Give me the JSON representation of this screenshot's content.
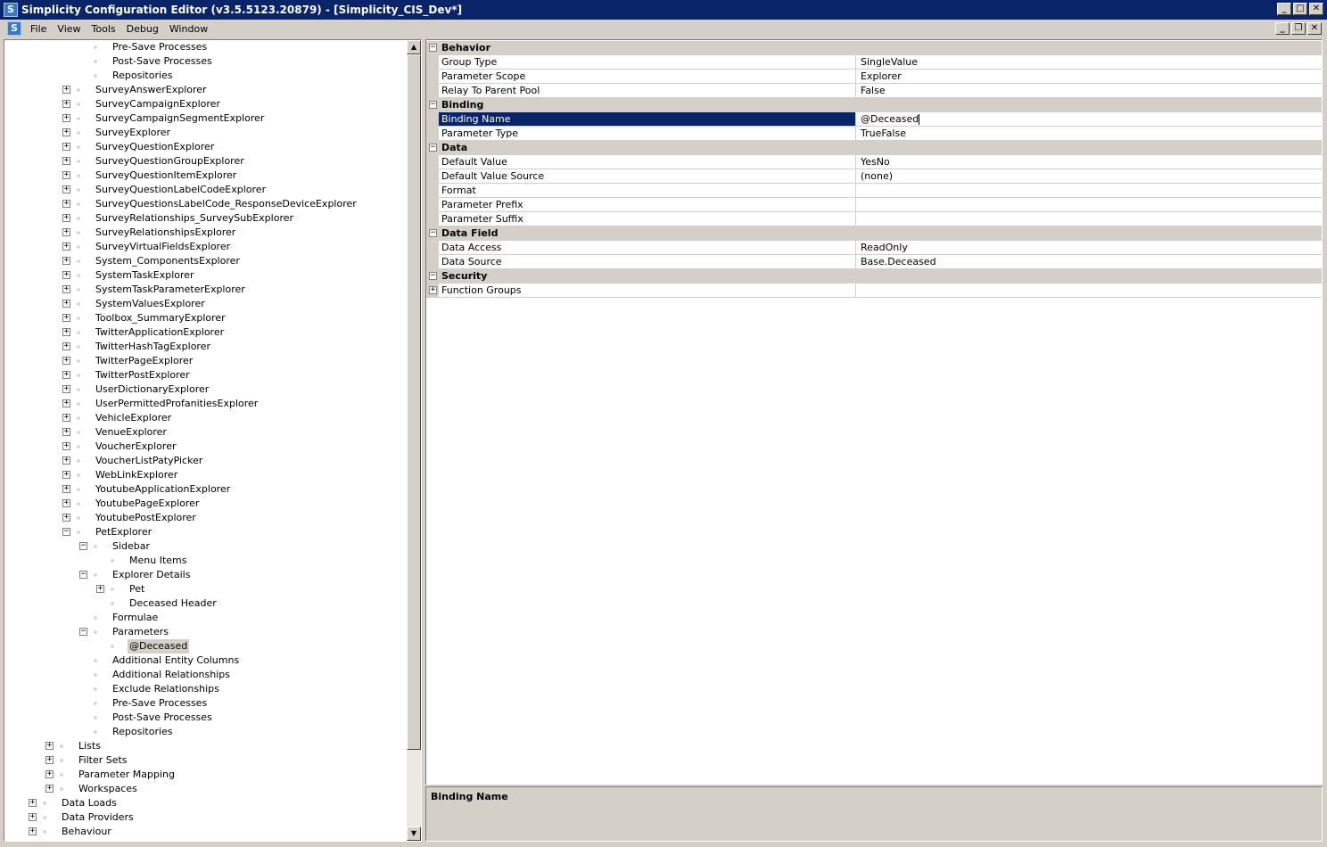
{
  "window": {
    "title": "Simplicity Configuration Editor (v3.5.5123.20879) - [Simplicity_CIS_Dev*]",
    "app_icon_letter": "S"
  },
  "menubar": {
    "items": [
      "File",
      "View",
      "Tools",
      "Debug",
      "Window"
    ]
  },
  "tree": {
    "items": [
      {
        "label": "Pre-Save Processes",
        "level": 3,
        "expander": "none"
      },
      {
        "label": "Post-Save Processes",
        "level": 3,
        "expander": "none"
      },
      {
        "label": "Repositories",
        "level": 3,
        "expander": "none"
      },
      {
        "label": "SurveyAnswerExplorer",
        "level": 2,
        "expander": "plus"
      },
      {
        "label": "SurveyCampaignExplorer",
        "level": 2,
        "expander": "plus"
      },
      {
        "label": "SurveyCampaignSegmentExplorer",
        "level": 2,
        "expander": "plus"
      },
      {
        "label": "SurveyExplorer",
        "level": 2,
        "expander": "plus"
      },
      {
        "label": "SurveyQuestionExplorer",
        "level": 2,
        "expander": "plus"
      },
      {
        "label": "SurveyQuestionGroupExplorer",
        "level": 2,
        "expander": "plus"
      },
      {
        "label": "SurveyQuestionItemExplorer",
        "level": 2,
        "expander": "plus"
      },
      {
        "label": "SurveyQuestionLabelCodeExplorer",
        "level": 2,
        "expander": "plus"
      },
      {
        "label": "SurveyQuestionsLabelCode_ResponseDeviceExplorer",
        "level": 2,
        "expander": "plus"
      },
      {
        "label": "SurveyRelationships_SurveySubExplorer",
        "level": 2,
        "expander": "plus"
      },
      {
        "label": "SurveyRelationshipsExplorer",
        "level": 2,
        "expander": "plus"
      },
      {
        "label": "SurveyVirtualFieldsExplorer",
        "level": 2,
        "expander": "plus"
      },
      {
        "label": "System_ComponentsExplorer",
        "level": 2,
        "expander": "plus"
      },
      {
        "label": "SystemTaskExplorer",
        "level": 2,
        "expander": "plus"
      },
      {
        "label": "SystemTaskParameterExplorer",
        "level": 2,
        "expander": "plus"
      },
      {
        "label": "SystemValuesExplorer",
        "level": 2,
        "expander": "plus"
      },
      {
        "label": "Toolbox_SummaryExplorer",
        "level": 2,
        "expander": "plus"
      },
      {
        "label": "TwitterApplicationExplorer",
        "level": 2,
        "expander": "plus"
      },
      {
        "label": "TwitterHashTagExplorer",
        "level": 2,
        "expander": "plus"
      },
      {
        "label": "TwitterPageExplorer",
        "level": 2,
        "expander": "plus"
      },
      {
        "label": "TwitterPostExplorer",
        "level": 2,
        "expander": "plus"
      },
      {
        "label": "UserDictionaryExplorer",
        "level": 2,
        "expander": "plus"
      },
      {
        "label": "UserPermittedProfanitiesExplorer",
        "level": 2,
        "expander": "plus"
      },
      {
        "label": "VehicleExplorer",
        "level": 2,
        "expander": "plus"
      },
      {
        "label": "VenueExplorer",
        "level": 2,
        "expander": "plus"
      },
      {
        "label": "VoucherExplorer",
        "level": 2,
        "expander": "plus"
      },
      {
        "label": "VoucherListPatyPicker",
        "level": 2,
        "expander": "plus"
      },
      {
        "label": "WebLinkExplorer",
        "level": 2,
        "expander": "plus"
      },
      {
        "label": "YoutubeApplicationExplorer",
        "level": 2,
        "expander": "plus"
      },
      {
        "label": "YoutubePageExplorer",
        "level": 2,
        "expander": "plus"
      },
      {
        "label": "YoutubePostExplorer",
        "level": 2,
        "expander": "plus"
      },
      {
        "label": "PetExplorer",
        "level": 2,
        "expander": "minus"
      },
      {
        "label": "Sidebar",
        "level": 3,
        "expander": "minus"
      },
      {
        "label": "Menu Items",
        "level": 4,
        "expander": "none"
      },
      {
        "label": "Explorer Details",
        "level": 3,
        "expander": "minus"
      },
      {
        "label": "Pet",
        "level": 4,
        "expander": "plus"
      },
      {
        "label": "Deceased Header",
        "level": 4,
        "expander": "none"
      },
      {
        "label": "Formulae",
        "level": 3,
        "expander": "none"
      },
      {
        "label": "Parameters",
        "level": 3,
        "expander": "minus"
      },
      {
        "label": "@Deceased",
        "level": 4,
        "expander": "none",
        "selected": true
      },
      {
        "label": "Additional Entity Columns",
        "level": 3,
        "expander": "none"
      },
      {
        "label": "Additional Relationships",
        "level": 3,
        "expander": "none"
      },
      {
        "label": "Exclude Relationships",
        "level": 3,
        "expander": "none"
      },
      {
        "label": "Pre-Save Processes",
        "level": 3,
        "expander": "none"
      },
      {
        "label": "Post-Save Processes",
        "level": 3,
        "expander": "none"
      },
      {
        "label": "Repositories",
        "level": 3,
        "expander": "none"
      },
      {
        "label": "Lists",
        "level": 1,
        "expander": "plus"
      },
      {
        "label": "Filter Sets",
        "level": 1,
        "expander": "plus"
      },
      {
        "label": "Parameter Mapping",
        "level": 1,
        "expander": "plus"
      },
      {
        "label": "Workspaces",
        "level": 1,
        "expander": "plus"
      },
      {
        "label": "Data Loads",
        "level": 0,
        "expander": "plus"
      },
      {
        "label": "Data Providers",
        "level": 0,
        "expander": "plus"
      },
      {
        "label": "Behaviour",
        "level": 0,
        "expander": "plus"
      }
    ]
  },
  "properties": {
    "categories": [
      {
        "name": "Behavior",
        "rows": [
          {
            "name": "Group Type",
            "value": "SingleValue"
          },
          {
            "name": "Parameter Scope",
            "value": "Explorer"
          },
          {
            "name": "Relay To Parent Pool",
            "value": "False"
          }
        ]
      },
      {
        "name": "Binding",
        "rows": [
          {
            "name": "Binding Name",
            "value": "@Deceased",
            "selected": true
          },
          {
            "name": "Parameter Type",
            "value": "TrueFalse"
          }
        ]
      },
      {
        "name": "Data",
        "rows": [
          {
            "name": "Default Value",
            "value": "YesNo"
          },
          {
            "name": "Default Value Source",
            "value": "(none)"
          },
          {
            "name": "Format",
            "value": ""
          },
          {
            "name": "Parameter Prefix",
            "value": ""
          },
          {
            "name": "Parameter Suffix",
            "value": ""
          }
        ]
      },
      {
        "name": "Data Field",
        "rows": [
          {
            "name": "Data Access",
            "value": "ReadOnly"
          },
          {
            "name": "Data Source",
            "value": "Base.Deceased"
          }
        ]
      },
      {
        "name": "Security",
        "rows": [
          {
            "name": "Function Groups",
            "value": "",
            "expandable": true
          }
        ]
      }
    ]
  },
  "help": {
    "title": "Binding Name"
  },
  "colors": {
    "titlebar": "#0a246a",
    "face": "#d4d0c8",
    "selection": "#0a246a"
  }
}
